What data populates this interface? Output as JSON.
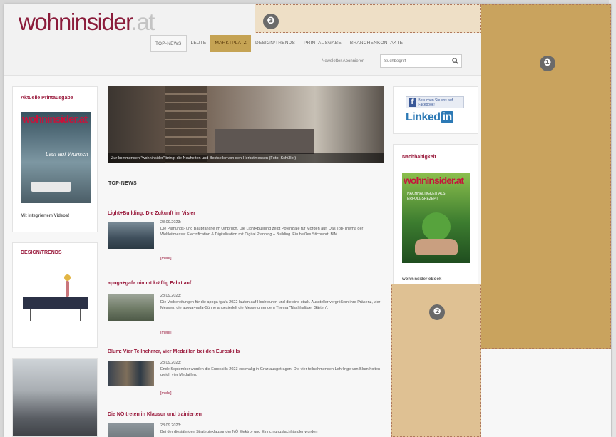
{
  "site": {
    "logo_name": "wohninsider",
    "logo_tld": ".at"
  },
  "nav": {
    "items": [
      {
        "label": "TOP-NEWS"
      },
      {
        "label": "LEUTE"
      },
      {
        "label": "MARKTPLATZ"
      },
      {
        "label": "DESIGN/TRENDS"
      },
      {
        "label": "PRINTAUSGABE"
      },
      {
        "label": "BRANCHENKONTAKTE"
      }
    ]
  },
  "header": {
    "newsletter_label": "Newsletter Abonnieren",
    "search_placeholder": "Suchbegriff",
    "search_icon": "search-icon"
  },
  "left": {
    "print_title": "Aktuelle Printausgabe",
    "print_mag_logo": "wohninsider.at",
    "print_mag_sub": "Last auf Wunsch",
    "print_caption": "Mit integriertem Videos!",
    "design_title": "DESIGN/TRENDS"
  },
  "hero": {
    "caption": "Zur kommenden \"wohninsider\" bringt die Neuheiten und Bestseller von den Herbstmessen (Foto: Schüller)"
  },
  "section_heading": "TOP-NEWS",
  "articles": [
    {
      "title": "Light+Building: Die Zukunft im Visier",
      "date": "28.09.2023:",
      "text": "Die Planungs- und Baubranche im Umbruch. Die Light+Building zeigt Potenziale für Morgen auf. Das Top-Thema der Weltleitmesse: Electrification & Digitalisation mit Digital Planning + Building. Ein heißes Stichwort: BIM.",
      "more": "[mehr]"
    },
    {
      "title": "apoga+gafa nimmt kräftig Fahrt auf",
      "date": "28.09.2023:",
      "text": "Die Vorbereitungen für die apoga+gafa 2022 laufen auf Hochtouren und die sind stark. Aussteller vergrößern ihre Präsenz, vier Messen, die apoga+gafa-Bühne angesiedelt die Messe unter dem Thema \"Nachhaltiger Gärten\".",
      "more": "[mehr]"
    },
    {
      "title": "Blum: Vier Teilnehmer, vier Medaillen bei den Euroskills",
      "date": "28.09.2023:",
      "text": "Ende September wurden die Euroskills 2023 erstmalig in Graz ausgetragen. Die vier teilnehmenden Lehrlinge von Blum holten gleich vier Medaillen.",
      "more": "[mehr]"
    },
    {
      "title": "Die NÖ treten in Klausur und trainierten",
      "date": "28.09.2023:",
      "text": "Bei der diesjährigen Strategieklausur der NÖ Elektro- und Einrichtungsfachhändler wurden",
      "more": ""
    }
  ],
  "right": {
    "facebook_text": "Besuchen Sie uns auf Facebook!",
    "linkedin_text": "Linked",
    "linkedin_in": "in",
    "sustain_title": "Nachhaltigkeit",
    "sustain_mag_logo": "wohninsider.at",
    "sustain_mag_headline": "NACHHALTIGKEIT ALS ERFOLGSREZEPT",
    "sustain_caption": "wohninsider eBook"
  },
  "markers": {
    "one": "❶",
    "two": "❷",
    "three": "❸"
  },
  "colors": {
    "brand": "#8b1c3b",
    "overlay_1": "#c9a35e",
    "overlay_2": "#dfc193",
    "overlay_3": "#eedfc6"
  }
}
